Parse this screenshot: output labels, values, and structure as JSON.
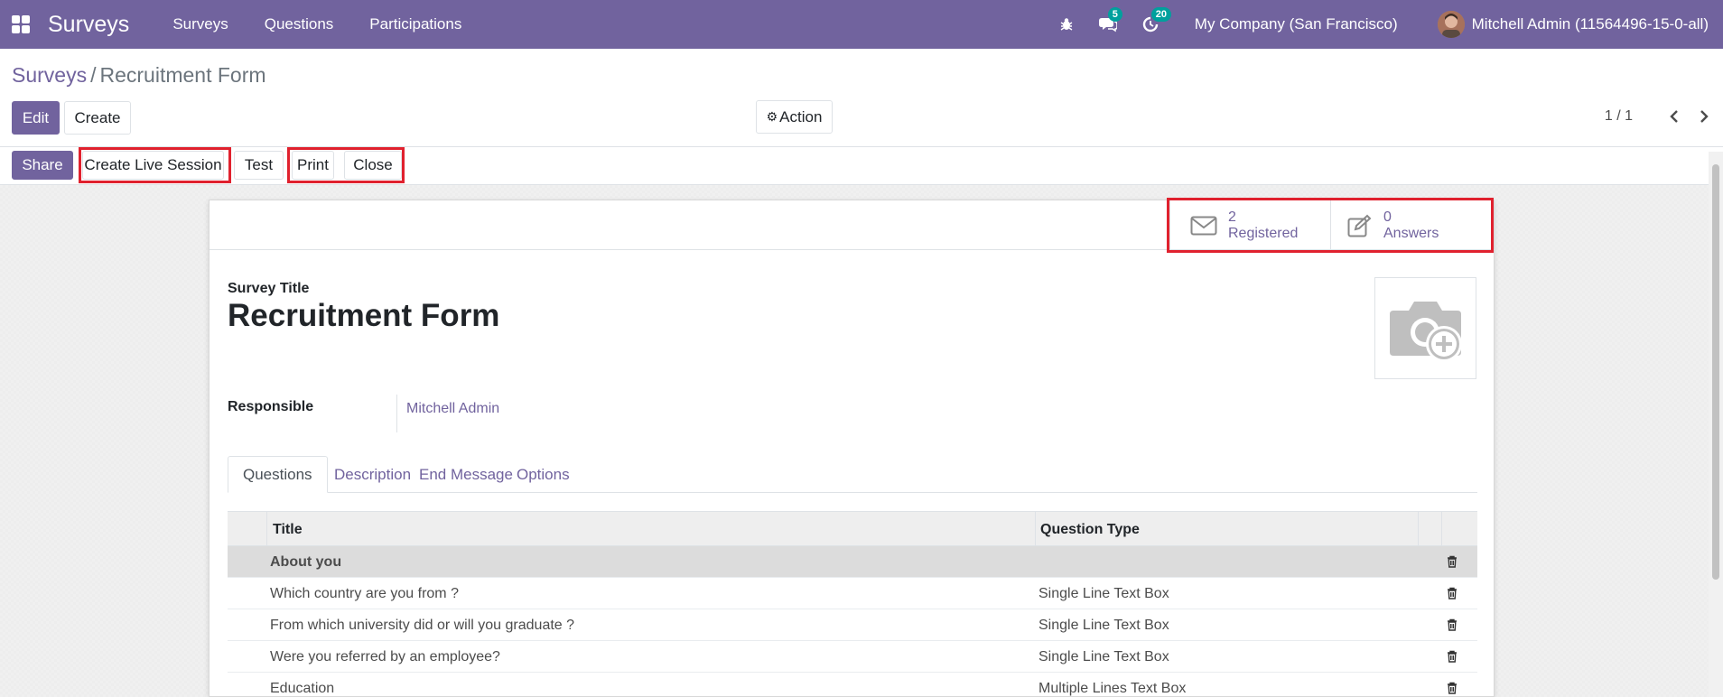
{
  "navbar": {
    "brand": "Surveys",
    "menu": [
      "Surveys",
      "Questions",
      "Participations"
    ],
    "messages_badge": "5",
    "activities_badge": "20",
    "company": "My Company (San Francisco)",
    "user": "Mitchell Admin (11564496-15-0-all)"
  },
  "breadcrumb": {
    "parent": "Surveys",
    "separator": "/",
    "current": "Recruitment Form"
  },
  "control": {
    "edit_label": "Edit",
    "create_label": "Create",
    "action_label": "Action",
    "pager": "1 / 1"
  },
  "statusbar": {
    "share_label": "Share",
    "live_session_label": "Create Live Session",
    "test_label": "Test",
    "print_label": "Print",
    "close_label": "Close"
  },
  "stats": {
    "registered_value": "2",
    "registered_label": "Registered",
    "answers_value": "0",
    "answers_label": "Answers"
  },
  "form": {
    "title_label": "Survey Title",
    "title": "Recruitment Form",
    "responsible_label": "Responsible",
    "responsible": "Mitchell Admin"
  },
  "tabs": [
    "Questions",
    "Description",
    "End Message",
    "Options"
  ],
  "table": {
    "headers": {
      "title": "Title",
      "type": "Question Type"
    },
    "rows": [
      {
        "title": "About you",
        "type": "",
        "section": true
      },
      {
        "title": "Which country are you from ?",
        "type": "Single Line Text Box",
        "section": false
      },
      {
        "title": "From which university did or will you graduate ?",
        "type": "Single Line Text Box",
        "section": false
      },
      {
        "title": "Were you referred by an employee?",
        "type": "Single Line Text Box",
        "section": false
      },
      {
        "title": "Education",
        "type": "Multiple Lines Text Box",
        "section": false
      }
    ]
  },
  "colors": {
    "brand": "#71639e",
    "highlight": "#e0212e",
    "badge": "#00a09d"
  }
}
